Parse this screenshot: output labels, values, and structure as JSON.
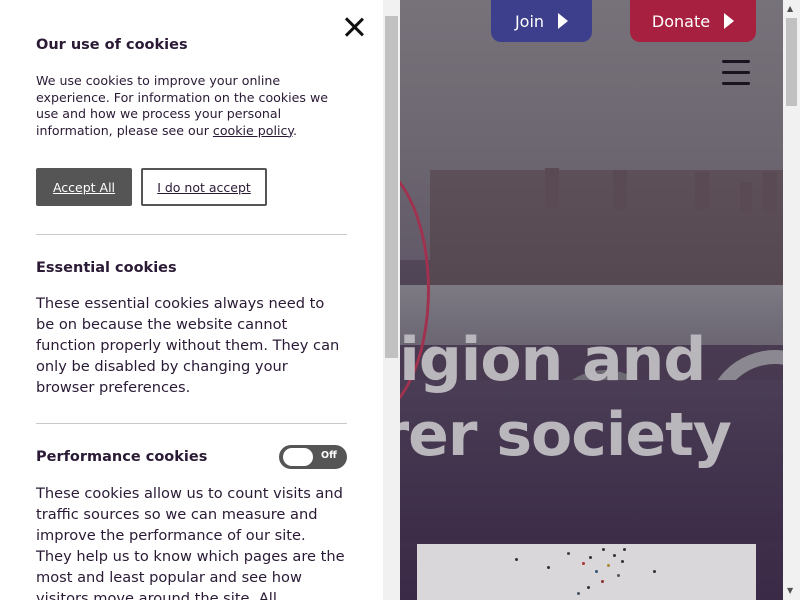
{
  "site": {
    "join_label": "Join",
    "donate_label": "Donate",
    "hero_line1": "eligion and",
    "hero_line2": "irer society"
  },
  "cookie_panel": {
    "title": "Our use of cookies",
    "intro": "We use cookies to improve your online experience. For information on the cookies we use and how we process your personal information, please see our ",
    "intro_link": "cookie policy",
    "intro_end": ".",
    "accept_label": "Accept All",
    "deny_label": "I do not accept",
    "essential": {
      "title": "Essential cookies",
      "text": "These essential cookies always need to be on because the website cannot function properly without them. They can only be disabled by changing your browser preferences."
    },
    "performance": {
      "title": "Performance cookies",
      "toggle_state": "Off",
      "text": "These cookies allow us to count visits and traffic sources so we can measure and improve the performance of our site. They help us to know which pages are the most and least popular and see how visitors move around the site. All information these"
    }
  },
  "icons": [
    "close-icon",
    "hamburger-menu-icon",
    "arrow-right-icon",
    "scroll-up-arrow-icon",
    "scroll-down-arrow-icon"
  ],
  "colors": {
    "join": "#3e3f8c",
    "donate": "#a8203f",
    "accept_button": "#555555",
    "panel_text": "#2a1a35"
  }
}
